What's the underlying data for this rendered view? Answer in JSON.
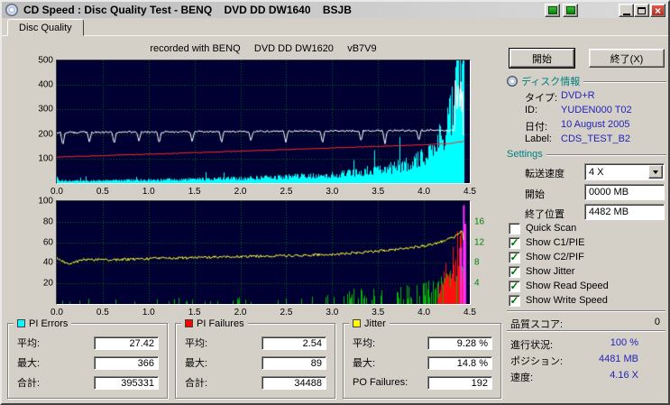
{
  "window": {
    "title": "CD Speed : Disc Quality Test - BENQ    DVD DD DW1640    BSJB"
  },
  "tabs": [
    {
      "label": "Disc Quality"
    }
  ],
  "chart_header": "recorded with BENQ     DVD DD DW1620     vB7V9",
  "actions": {
    "start": "開始",
    "exit": "終了(X)"
  },
  "disc_info": {
    "header": "ディスク情報",
    "rows": [
      {
        "label": "タイプ:",
        "value": "DVD+R"
      },
      {
        "label": "ID:",
        "value": "YUDEN000 T02"
      },
      {
        "label": "日付:",
        "value": "10 August 2005"
      },
      {
        "label": "Label:",
        "value": "CDS_TEST_B2"
      }
    ]
  },
  "settings": {
    "header": "Settings",
    "transfer_speed": {
      "label": "転送速度",
      "value": "4 X"
    },
    "start_pos": {
      "label": "開始",
      "value": "0000 MB"
    },
    "end_pos": {
      "label": "終了位置",
      "value": "4482 MB"
    },
    "checkboxes": [
      {
        "label": "Quick Scan",
        "checked": false
      },
      {
        "label": "Show C1/PIE",
        "checked": true
      },
      {
        "label": "Show C2/PIF",
        "checked": true
      },
      {
        "label": "Show Jitter",
        "checked": true
      },
      {
        "label": "Show Read Speed",
        "checked": true
      },
      {
        "label": "Show Write Speed",
        "checked": true
      }
    ]
  },
  "quality_score": {
    "label": "品質スコア:",
    "value": "0"
  },
  "status": {
    "progress": {
      "label": "進行状況:",
      "value": "100 %"
    },
    "position": {
      "label": "ポジション:",
      "value": "4481 MB"
    },
    "speed": {
      "label": "速度:",
      "value": "4.16 X"
    }
  },
  "stats_boxes": [
    {
      "title": "PI Errors",
      "color": "#00ffff",
      "rows": [
        {
          "label": "平均:",
          "value": "27.42"
        },
        {
          "label": "最大:",
          "value": "366"
        },
        {
          "label": "合計:",
          "value": "395331"
        }
      ]
    },
    {
      "title": "PI Failures",
      "color": "#ff0000",
      "rows": [
        {
          "label": "平均:",
          "value": "2.54"
        },
        {
          "label": "最大:",
          "value": "89"
        },
        {
          "label": "合計:",
          "value": "34488"
        }
      ]
    },
    {
      "title": "Jitter",
      "color": "#ffff00",
      "rows": [
        {
          "label": "平均:",
          "value": "9.28 %"
        },
        {
          "label": "最大:",
          "value": "14.8 %"
        },
        {
          "label": "PO Failures:",
          "value": "192"
        }
      ]
    }
  ],
  "chart_data": [
    {
      "type": "area",
      "name": "PI Errors with read/write speed vs disc position (GB)",
      "x_range": [
        0,
        4.5
      ],
      "x_tick_step": 0.5,
      "x_data_end": 4.44,
      "x_ticks": [
        "0.0",
        "0.5",
        "1.0",
        "1.5",
        "2.0",
        "2.5",
        "3.0",
        "3.5",
        "4.0",
        "4.5"
      ],
      "y_range": [
        0,
        500
      ],
      "y_ticks": [
        100,
        200,
        300,
        400,
        500
      ],
      "bg": "#000033",
      "grid_color": "#0a6e0a",
      "series": [
        {
          "name": "C1/PIE errors",
          "type": "area",
          "color": "#00ffff",
          "noise": 0.4,
          "spike_prob": 0.03,
          "spike_mult": 2.2,
          "points": [
            [
              0,
              26
            ],
            [
              0.04,
              10
            ],
            [
              0.3,
              9
            ],
            [
              0.6,
              11
            ],
            [
              1.0,
              13
            ],
            [
              1.5,
              16
            ],
            [
              2.0,
              20
            ],
            [
              2.5,
              26
            ],
            [
              2.8,
              30
            ],
            [
              3.0,
              34
            ],
            [
              3.2,
              40
            ],
            [
              3.4,
              48
            ],
            [
              3.6,
              58
            ],
            [
              3.8,
              75
            ],
            [
              3.95,
              95
            ],
            [
              4.05,
              125
            ],
            [
              4.15,
              170
            ],
            [
              4.25,
              240
            ],
            [
              4.32,
              330
            ],
            [
              4.38,
              440
            ],
            [
              4.42,
              500
            ],
            [
              4.44,
              480
            ]
          ]
        },
        {
          "name": "read speed",
          "type": "line",
          "color": "#ff2a2a",
          "noise_abs": 1.5,
          "points": [
            [
              0,
              106
            ],
            [
              1.0,
              118
            ],
            [
              2.0,
              130
            ],
            [
              3.0,
              143
            ],
            [
              4.0,
              156
            ],
            [
              4.3,
              162
            ],
            [
              4.44,
              170
            ]
          ]
        },
        {
          "name": "write speed",
          "type": "line",
          "color": "#ffffff",
          "noise_abs": 4,
          "points": [
            [
              0,
              206
            ],
            [
              2.0,
              210
            ],
            [
              4.44,
              216
            ]
          ],
          "dips": [
            [
              0.07,
              152
            ],
            [
              0.36,
              166
            ],
            [
              0.63,
              158
            ],
            [
              0.9,
              170
            ],
            [
              1.12,
              160
            ],
            [
              1.48,
              168
            ],
            [
              1.8,
              162
            ],
            [
              2.12,
              170
            ],
            [
              2.5,
              165
            ],
            [
              2.9,
              160
            ],
            [
              3.32,
              168
            ],
            [
              3.58,
              157
            ],
            [
              3.95,
              170
            ]
          ],
          "end_burst": {
            "from": 4.34,
            "low": 160,
            "high": 500
          }
        }
      ]
    },
    {
      "type": "mixed",
      "name": "PI Failures / PO Failures / Jitter vs disc position (GB)",
      "x_range": [
        0,
        4.5
      ],
      "x_tick_step": 0.5,
      "x_data_end": 4.44,
      "x_ticks": [
        "0.0",
        "0.5",
        "1.0",
        "1.5",
        "2.0",
        "2.5",
        "3.0",
        "3.5",
        "4.0",
        "4.5"
      ],
      "y_range": [
        0,
        100
      ],
      "y_ticks": [
        20,
        40,
        60,
        80,
        100
      ],
      "y_right_ticks": [
        {
          "v": 80,
          "label": "16"
        },
        {
          "v": 60,
          "label": "12"
        },
        {
          "v": 40,
          "label": "8"
        },
        {
          "v": 20,
          "label": "4"
        }
      ],
      "bg": "#000033",
      "grid_color": "#0a6e0a",
      "series": [
        {
          "name": "C2/PIF spikes",
          "type": "spikes",
          "color": "#00b400",
          "density": [
            [
              0,
              0.05
            ],
            [
              1,
              0.07
            ],
            [
              2,
              0.09
            ],
            [
              3,
              0.14
            ],
            [
              3.3,
              0.38
            ],
            [
              3.5,
              0.2
            ],
            [
              3.8,
              0.35
            ],
            [
              4.0,
              0.55
            ],
            [
              4.2,
              0.85
            ],
            [
              4.44,
              0.95
            ]
          ],
          "max_h": [
            [
              0,
              5
            ],
            [
              1,
              6
            ],
            [
              2,
              7
            ],
            [
              3,
              9
            ],
            [
              3.3,
              18
            ],
            [
              3.6,
              14
            ],
            [
              4.0,
              22
            ],
            [
              4.2,
              32
            ],
            [
              4.44,
              42
            ]
          ]
        },
        {
          "name": "PIF burst",
          "type": "spikes",
          "color": "#ff1010",
          "density": [
            [
              0,
              0
            ],
            [
              4.1,
              0
            ],
            [
              4.16,
              0.6
            ],
            [
              4.25,
              0.95
            ],
            [
              4.44,
              1
            ]
          ],
          "max_h": [
            [
              0,
              0
            ],
            [
              4.1,
              0
            ],
            [
              4.18,
              25
            ],
            [
              4.28,
              50
            ],
            [
              4.36,
              72
            ],
            [
              4.44,
              88
            ]
          ]
        },
        {
          "name": "PO failures",
          "type": "vlines",
          "color": "#ff30ff",
          "lines": [
            [
              4.4,
              55
            ],
            [
              4.43,
              96
            ],
            [
              4.445,
              78
            ]
          ]
        },
        {
          "name": "jitter",
          "type": "line",
          "color": "#ffff30",
          "noise_abs": 1.3,
          "points": [
            [
              0,
              45
            ],
            [
              0.12,
              39
            ],
            [
              0.3,
              43
            ],
            [
              0.6,
              43
            ],
            [
              1.0,
              44
            ],
            [
              1.5,
              45
            ],
            [
              2.0,
              46
            ],
            [
              2.5,
              47
            ],
            [
              3.0,
              48
            ],
            [
              3.3,
              50
            ],
            [
              3.6,
              52
            ],
            [
              3.9,
              55
            ],
            [
              4.1,
              58
            ],
            [
              4.25,
              62
            ],
            [
              4.35,
              66
            ],
            [
              4.42,
              72
            ],
            [
              4.44,
              60
            ]
          ]
        }
      ]
    }
  ]
}
